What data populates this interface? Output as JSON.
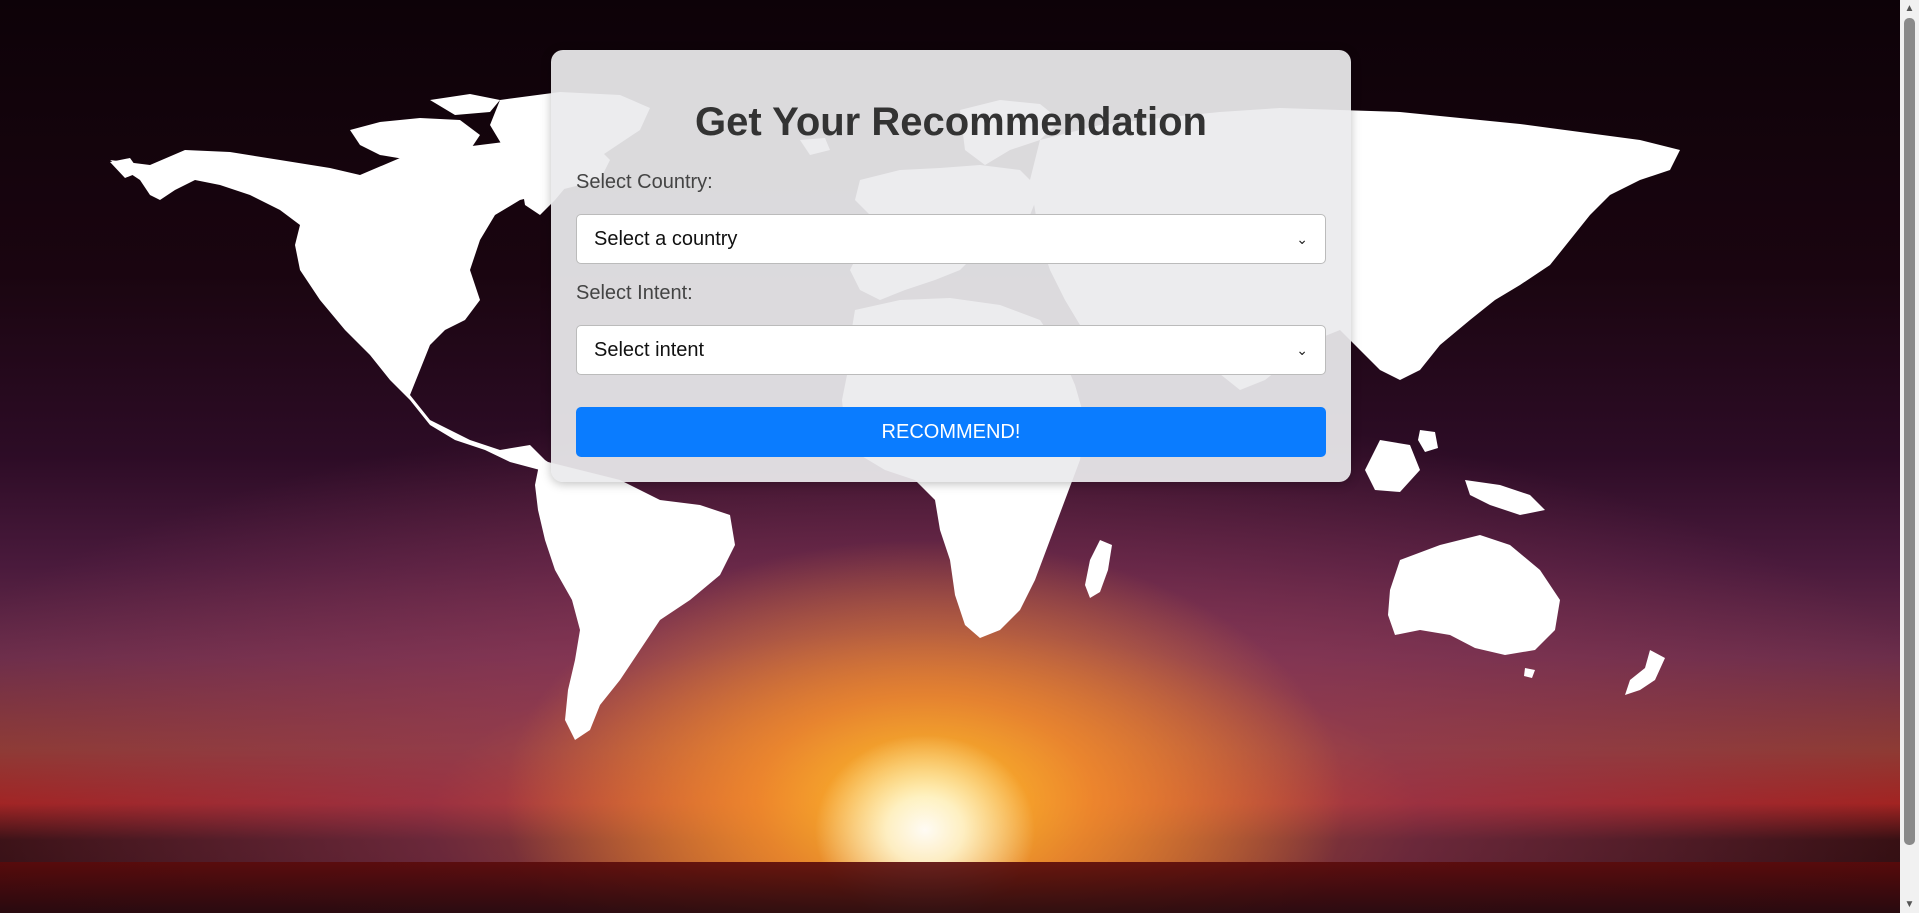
{
  "background": {
    "description_icon": "world-map-sunset"
  },
  "form": {
    "title": "Get Your Recommendation",
    "country_label": "Select Country:",
    "country_value": "Select a country",
    "intent_label": "Select Intent:",
    "intent_value": "Select intent",
    "submit_label": "RECOMMEND!"
  },
  "colors": {
    "button": "#0a7cff",
    "card": "#ebebed"
  }
}
